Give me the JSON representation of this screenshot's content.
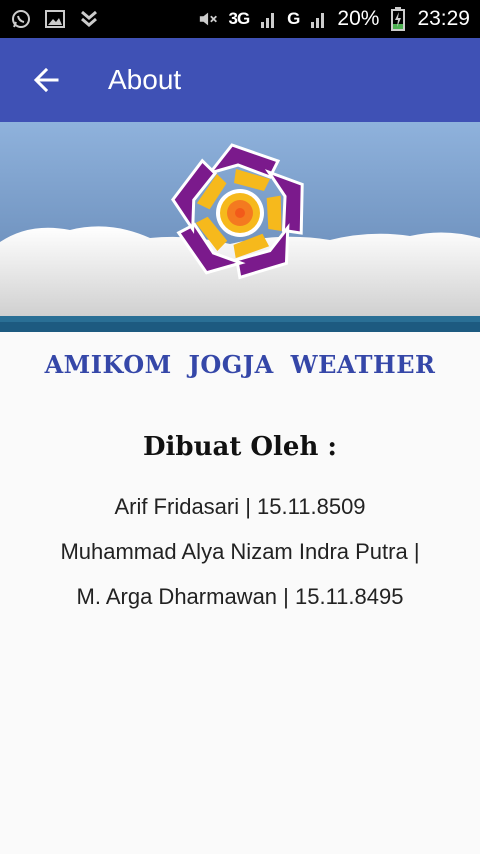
{
  "status_bar": {
    "network": "3G",
    "sim1": "G",
    "sim2": "G",
    "battery": "20%",
    "time": "23:29"
  },
  "app_bar": {
    "title": "About"
  },
  "about": {
    "app_name": "AMIKOM  JOGJA  WEATHER",
    "created_by": "Dibuat Oleh :",
    "authors": [
      "Arif Fridasari | 15.11.8509",
      "Muhammad Alya Nizam Indra Putra |",
      "M. Arga Dharmawan | 15.11.8495"
    ]
  },
  "colors": {
    "app_bar": "#3f51b5",
    "title_text": "#3547a8",
    "logo_purple": "#7b1a8c",
    "logo_yellow": "#f6b91c",
    "logo_orange": "#f47a20"
  }
}
